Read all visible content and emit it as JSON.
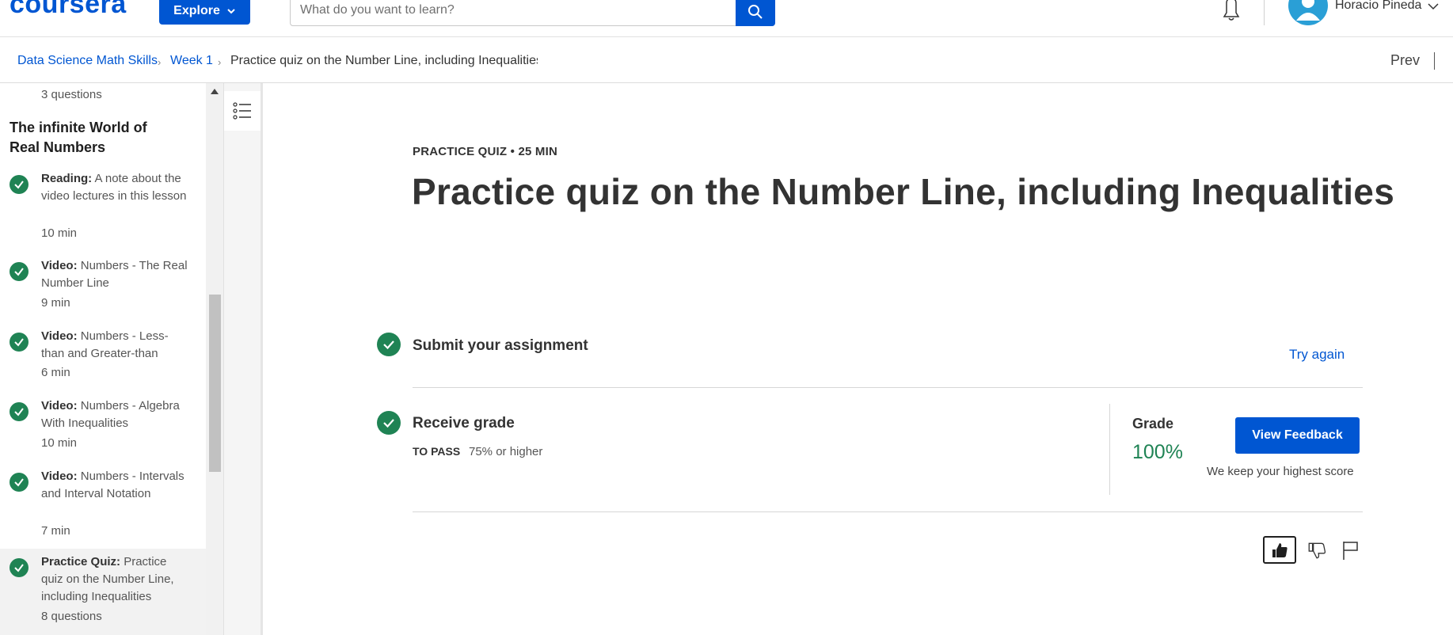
{
  "header": {
    "logo": "coursera",
    "explore_label": "Explore",
    "search_placeholder": "What do you want to learn?",
    "user_name": "Horacio Pineda"
  },
  "breadcrumb": {
    "items": [
      "Data Science Math Skills",
      "Week 1",
      "Practice quiz on the Number Line, including Inequalities"
    ],
    "prev_label": "Prev"
  },
  "sidebar": {
    "top_count": "3 questions",
    "section_heading": "The infinite World of Real Numbers",
    "items": [
      {
        "type": "Reading:",
        "title": "A note about the video lectures in this lesson",
        "duration": "10 min",
        "completed": true
      },
      {
        "type": "Video:",
        "title": "Numbers - The Real Number Line",
        "duration": "9 min",
        "completed": true
      },
      {
        "type": "Video:",
        "title": "Numbers - Less-than and Greater-than",
        "duration": "6 min",
        "completed": true
      },
      {
        "type": "Video:",
        "title": "Numbers - Algebra With Inequalities",
        "duration": "10 min",
        "completed": true
      },
      {
        "type": "Video:",
        "title": "Numbers - Intervals and Interval Notation",
        "duration": "7 min",
        "completed": true
      },
      {
        "type": "Practice Quiz:",
        "title": "Practice quiz on the Number Line, including Inequalities",
        "duration": "8 questions",
        "completed": true,
        "active": true
      }
    ]
  },
  "main": {
    "meta": "PRACTICE QUIZ • 25 MIN",
    "title": "Practice quiz on the Number Line, including Inequalities",
    "submit_label": "Submit your assignment",
    "try_again_label": "Try again",
    "receive_label": "Receive grade",
    "to_pass_label": "TO PASS",
    "to_pass_value": "75% or higher",
    "grade_label": "Grade",
    "grade_value": "100%",
    "view_feedback_label": "View Feedback",
    "highest_note": "We keep your highest score"
  },
  "colors": {
    "brand": "#0056d2",
    "success": "#1f8354"
  }
}
